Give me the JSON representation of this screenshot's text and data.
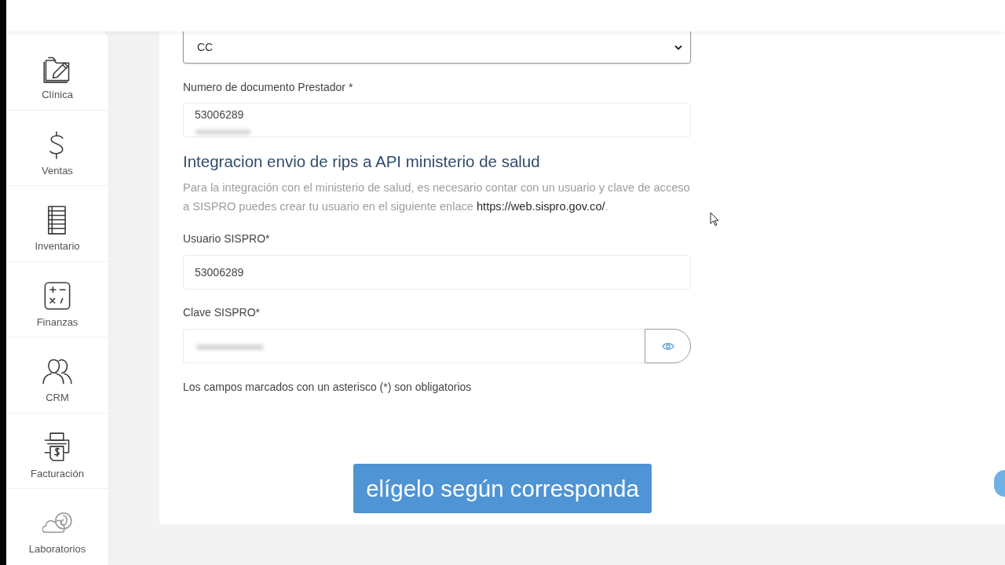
{
  "sidebar": {
    "items": [
      {
        "label": "Clínica"
      },
      {
        "label": "Ventas"
      },
      {
        "label": "Inventario"
      },
      {
        "label": "Finanzas"
      },
      {
        "label": "CRM"
      },
      {
        "label": "Facturación"
      },
      {
        "label": "Laboratorios"
      }
    ]
  },
  "form": {
    "document_type": {
      "value": "CC"
    },
    "document_number": {
      "label": "Numero de documento Prestador *",
      "value": "53006289"
    },
    "section_title": "Integracion envio de rips a API ministerio de salud",
    "description": {
      "text_before": "Para la integración con el ministerio de salud, es necesario contar con un usuario y clave de acceso a SISPRO puedes crear tu usuario en el siguiente enlace ",
      "link": "https://web.sispro.gov.co/",
      "text_after": "."
    },
    "user": {
      "label": "Usuario SISPRO*",
      "value": "53006289"
    },
    "password": {
      "label": "Clave SISPRO*"
    },
    "note": "Los campos marcados con un asterisco (*) son obligatorios"
  },
  "caption": "elígelo según corresponda"
}
